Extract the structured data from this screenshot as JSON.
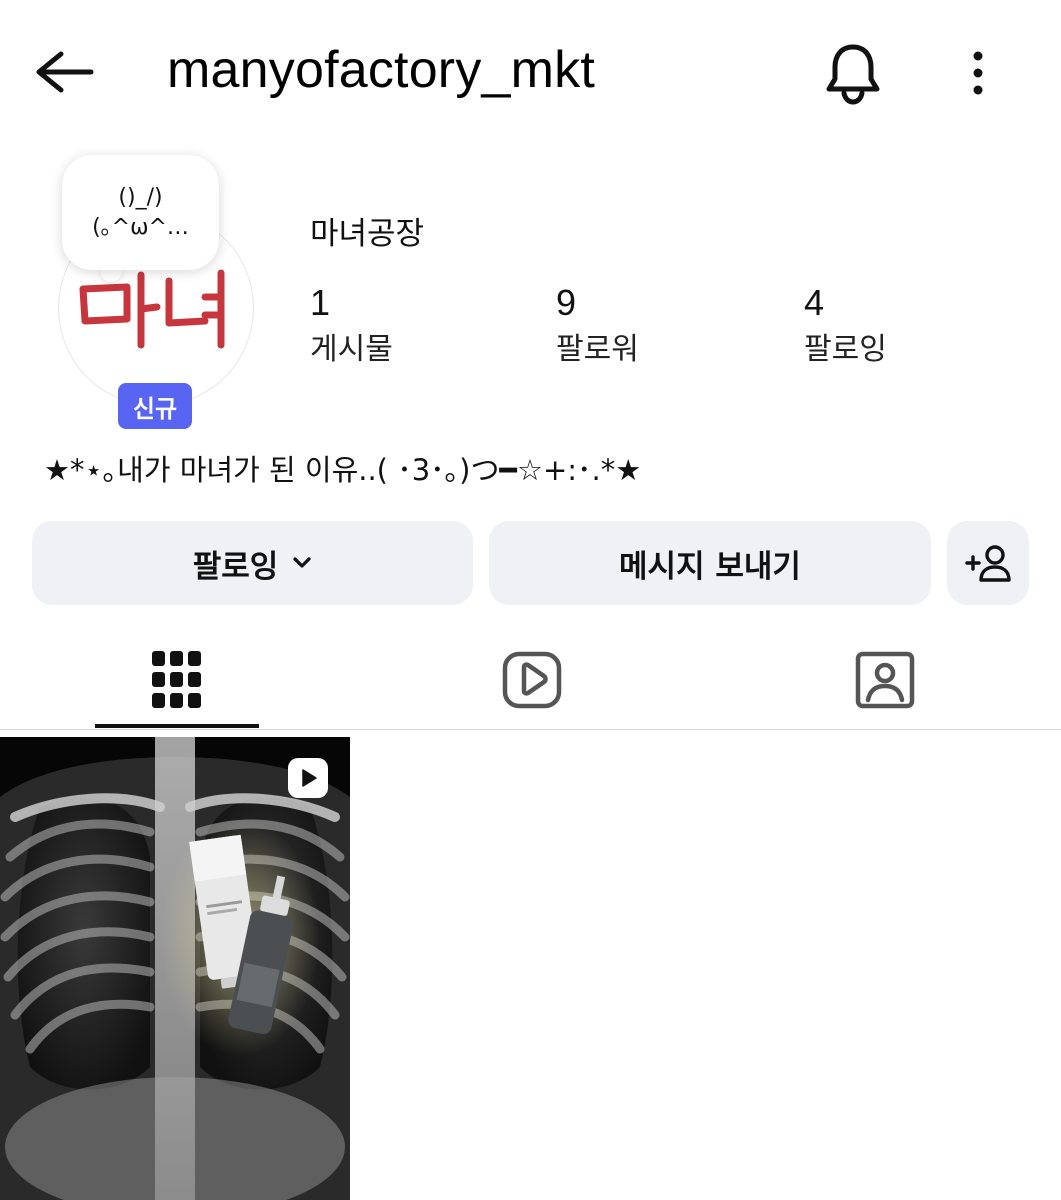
{
  "header": {
    "username": "manyofactory_mkt",
    "back_icon": "arrow-left-icon",
    "notification_icon": "bell-icon",
    "more_icon": "more-vertical-icon"
  },
  "profile": {
    "avatar_text": "마녀",
    "note_line1": "()_/)",
    "note_line2": "(｡^ω^…",
    "badge": "신규",
    "display_name": "마녀공장",
    "stats": {
      "posts_count": "1",
      "posts_label": "게시물",
      "followers_count": "9",
      "followers_label": "팔로워",
      "following_count": "4",
      "following_label": "팔로잉"
    },
    "bio": "★*⋆｡내가 마녀가 된 이유..( ･3･｡)つ━☆+:･.*★"
  },
  "actions": {
    "following_label": "팔로잉",
    "message_label": "메시지 보내기",
    "add_user_icon": "add-person-icon"
  },
  "tabs": {
    "grid_icon": "grid-icon",
    "reels_icon": "reels-icon",
    "tagged_icon": "tagged-icon",
    "active": "grid"
  },
  "posts": [
    {
      "type": "reel",
      "description_icon": "play-icon"
    }
  ],
  "colors": {
    "badge": "#5865f2",
    "button_bg": "#eff1f5",
    "avatar_text": "#c8363d"
  }
}
